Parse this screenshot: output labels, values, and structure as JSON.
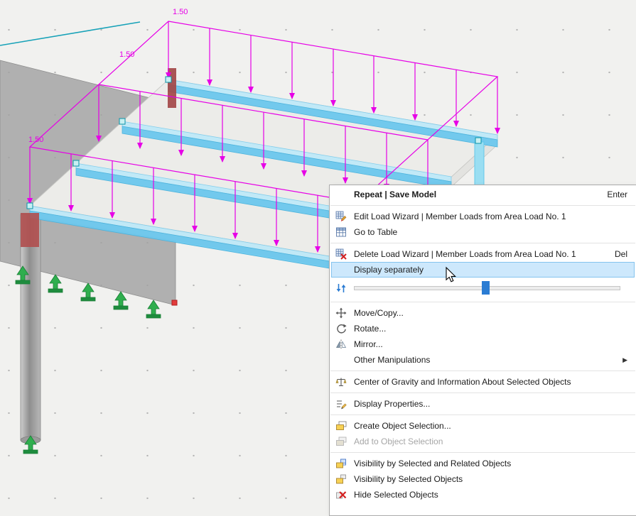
{
  "viewport": {
    "load_labels": [
      "1.50",
      "1.50",
      "1.50"
    ],
    "colors": {
      "load_magenta": "#e600e6",
      "beam_cyan": "#6cc8ee",
      "support_green": "#2fae4e",
      "node_teal": "#c8f0f2",
      "selection_red": "#e23b3b",
      "wall_gray": "#a0a0a0",
      "background": "#f1f1ef"
    }
  },
  "context_menu": {
    "highlight_color": "#cde8fc",
    "submenu_arrow_glyph": "▶",
    "slider": {
      "value_percent": 48,
      "icon": "sort-arrows-icon"
    },
    "items": [
      {
        "label": "Repeat | Save Model",
        "shortcut": "Enter",
        "bold": true
      },
      {
        "label": "Edit Load Wizard | Member Loads from Area Load No. 1",
        "icon": "load-wizard-edit-icon"
      },
      {
        "label": "Go to Table",
        "icon": "table-icon"
      },
      {
        "label": "Delete Load Wizard | Member Loads from Area Load No. 1",
        "shortcut": "Del",
        "icon": "load-wizard-delete-icon"
      },
      {
        "label": "Display separately",
        "state": "highlighted"
      },
      {
        "label": "Move/Copy...",
        "icon": "move-icon"
      },
      {
        "label": "Rotate...",
        "icon": "rotate-icon"
      },
      {
        "label": "Mirror...",
        "icon": "mirror-icon"
      },
      {
        "label": "Other Manipulations",
        "submenu": true
      },
      {
        "label": "Center of Gravity and Information About Selected Objects",
        "icon": "center-of-gravity-icon"
      },
      {
        "label": "Display Properties...",
        "icon": "display-properties-icon"
      },
      {
        "label": "Create Object Selection...",
        "icon": "create-selection-icon"
      },
      {
        "label": "Add to Object Selection",
        "state": "disabled",
        "icon": "add-selection-icon"
      },
      {
        "label": "Visibility by Selected and Related Objects",
        "icon": "visibility-related-icon"
      },
      {
        "label": "Visibility by Selected Objects",
        "icon": "visibility-selected-icon"
      },
      {
        "label": "Hide Selected Objects",
        "icon": "hide-objects-icon"
      }
    ]
  }
}
